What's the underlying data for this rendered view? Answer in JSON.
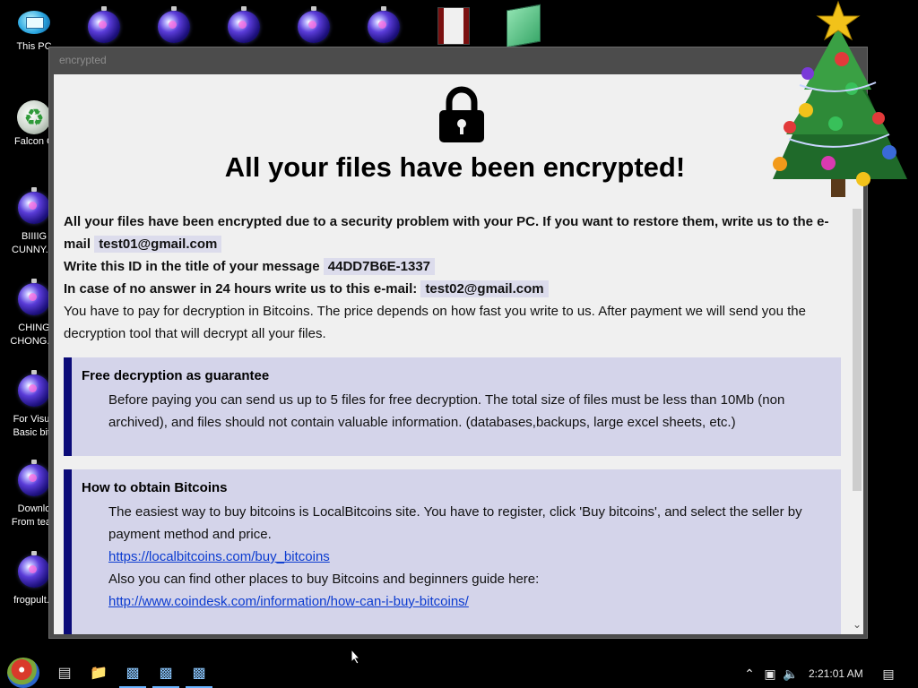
{
  "desktop": {
    "icons": [
      {
        "label": "This PC"
      },
      {
        "label": "Falcon C"
      },
      {
        "label": "BIIIIG"
      },
      {
        "label": "CUNNY.In"
      },
      {
        "label": "CHING"
      },
      {
        "label": "CHONG.In"
      },
      {
        "label": "For Visua"
      },
      {
        "label": "Basic bitc"
      },
      {
        "label": "Downlo"
      },
      {
        "label": "From tean"
      },
      {
        "label": "frogpult.e"
      }
    ]
  },
  "window": {
    "title": "encrypted",
    "heading": "All your files have been encrypted!",
    "intro_line1": "All your files have been encrypted due to a security problem with your PC. If you want to restore them, write us to the e-mail",
    "email1": "test01@gmail.com",
    "id_prompt": "Write this ID in the title of your message",
    "id_value": "44DD7B6E-1337",
    "no_answer_prompt": "In case of no answer in 24 hours write us to this e-mail:",
    "email2": "test02@gmail.com",
    "payment_text": "You have to pay for decryption in Bitcoins. The price depends on how fast you write to us. After payment we will send you the decryption tool that will decrypt all your files.",
    "guarantee": {
      "title": "Free decryption as guarantee",
      "body": "Before paying you can send us up to 5 files for free decryption. The total size of files must be less than 10Mb (non archived), and files should not contain valuable information. (databases,backups, large excel sheets, etc.)"
    },
    "bitcoins": {
      "title": "How to obtain Bitcoins",
      "body1": "The easiest way to buy bitcoins is LocalBitcoins site. You have to register, click 'Buy bitcoins', and select the seller by payment method and price.",
      "link1": "https://localbitcoins.com/buy_bitcoins",
      "body2": "Also you can find other places to buy Bitcoins and beginners guide here:",
      "link2": "http://www.coindesk.com/information/how-can-i-buy-bitcoins/"
    }
  },
  "taskbar": {
    "clock": "2:21:01 AM"
  },
  "colors": {
    "panel_bg": "#d4d4ea",
    "panel_accent": "#0b0b78",
    "link": "#0b3bd0"
  }
}
